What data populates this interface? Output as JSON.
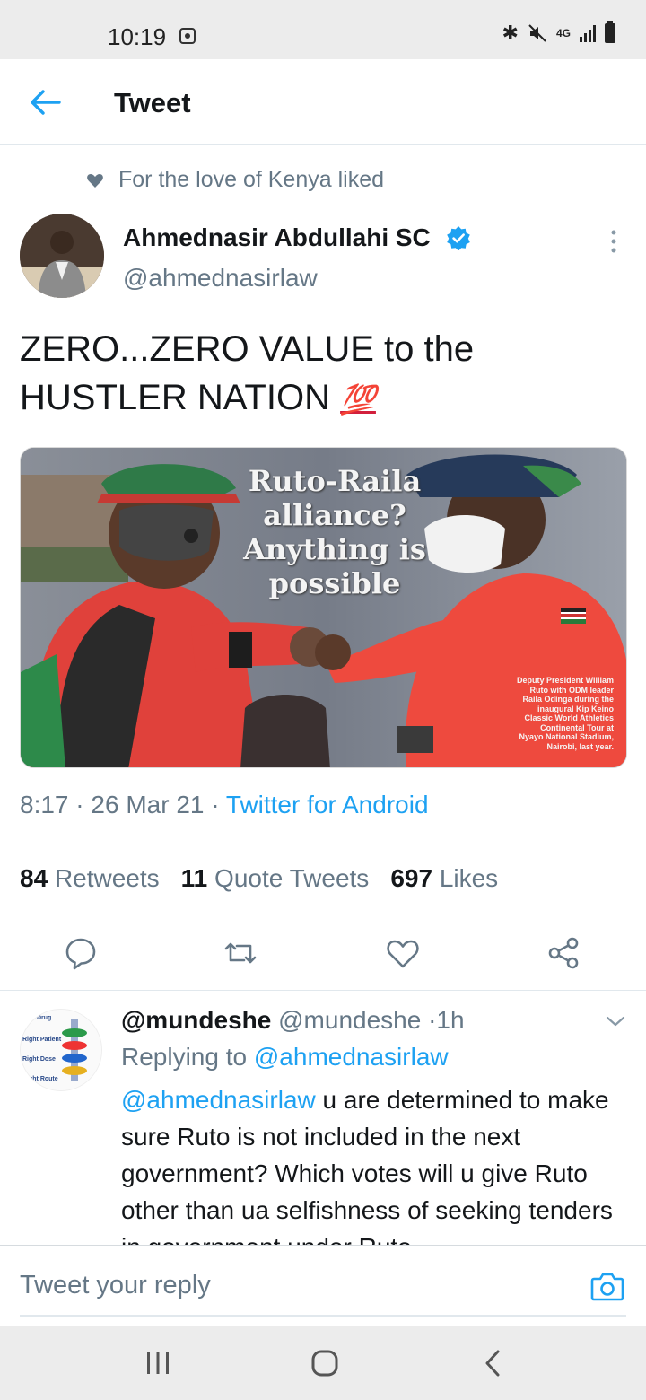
{
  "status_bar": {
    "time": "10:19",
    "network": "4G"
  },
  "header": {
    "title": "Tweet",
    "back_icon": "arrow-left-icon"
  },
  "social_context": {
    "text": "For the love of Kenya liked",
    "icon": "heart-icon"
  },
  "tweet": {
    "author_name": "Ahmednasir Abdullahi SC",
    "author_handle": "@ahmednasirlaw",
    "verified": true,
    "text": "ZERO...ZERO VALUE to the HUSTLER NATION",
    "emoji": "💯",
    "image": {
      "headline": "Ruto-Raila alliance? Anything is possible",
      "caption": "Deputy President William Ruto with ODM leader Raila Odinga during the inaugural Kip Keino Classic World Athletics Continental Tour at Nyayo National Stadium, Nairobi, last year."
    },
    "time": "8:17",
    "date": "26 Mar 21",
    "source": "Twitter for Android",
    "retweets": "84",
    "retweets_label": "Retweets",
    "quote_tweets": "11",
    "quote_tweets_label": "Quote Tweets",
    "likes": "697",
    "likes_label": "Likes"
  },
  "actions": [
    "reply-icon",
    "retweet-icon",
    "like-icon",
    "share-icon"
  ],
  "reply": {
    "display_name": "@mundeshe",
    "handle": "@mundeshe",
    "age": "1h",
    "replying_prefix": "Replying to",
    "replying_to": "@ahmednasirlaw",
    "mention": "@ahmednasirlaw",
    "body": "u are determined to make sure Ruto is not included in the next government? Which votes will u give Ruto other than ua selfishness of seeking tenders in government under Ruto",
    "avatar_labels": [
      "Drug",
      "Right Patient",
      "Right Dose",
      "Right Route"
    ]
  },
  "compose": {
    "placeholder": "Tweet your reply"
  },
  "colors": {
    "twitter_blue": "#1da1f2",
    "secondary_text": "#657786",
    "primary_text": "#14171a"
  }
}
